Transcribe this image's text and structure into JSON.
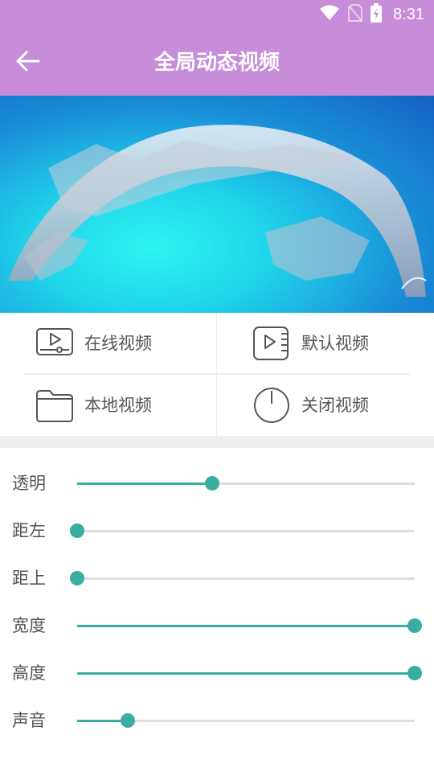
{
  "status_bar": {
    "time": "8:31",
    "icons": [
      "wifi-icon",
      "no-sim-icon",
      "battery-charging-icon"
    ]
  },
  "header": {
    "title": "全局动态视频",
    "back_icon": "arrow-left-icon",
    "background": "#c78cda"
  },
  "menu": {
    "items": [
      {
        "label": "在线视频",
        "icon": "online-video-icon"
      },
      {
        "label": "默认视频",
        "icon": "default-video-icon"
      },
      {
        "label": "本地视频",
        "icon": "folder-icon"
      },
      {
        "label": "关闭视频",
        "icon": "power-icon"
      }
    ]
  },
  "settings": {
    "accent": "#39ad9f",
    "sliders": [
      {
        "label": "透明",
        "value": 0.4
      },
      {
        "label": "距左",
        "value": 0.0
      },
      {
        "label": "距上",
        "value": 0.0
      },
      {
        "label": "宽度",
        "value": 1.0
      },
      {
        "label": "高度",
        "value": 1.0
      },
      {
        "label": "声音",
        "value": 0.15
      }
    ]
  }
}
